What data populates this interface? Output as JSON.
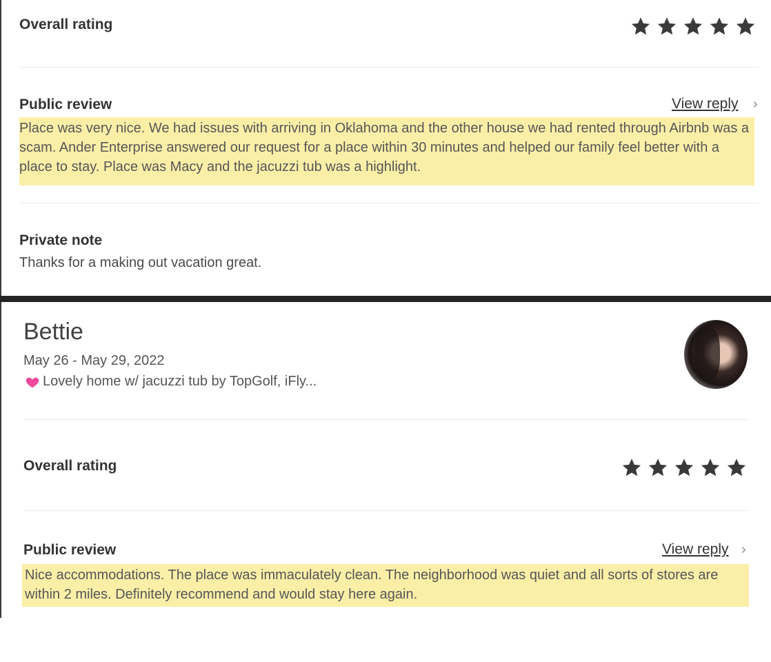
{
  "first_review": {
    "overall_rating_label": "Overall rating",
    "rating_stars": 5,
    "public_review_label": "Public review",
    "view_reply_label": "View reply",
    "public_review_text": "Place was very nice. We had issues with arriving in Oklahoma and the other house we had rented through Airbnb was a scam. Ander Enterprise answered our request for a place within 30 minutes and helped our family feel better with a place to stay. Place was Macy and the jacuzzi tub was a highlight.",
    "private_note_label": "Private note",
    "private_note_text": "Thanks for a making out vacation great."
  },
  "second_review": {
    "guest_name": "Bettie",
    "stay_dates": "May 26 - May 29, 2022",
    "listing_title": "Lovely home w/ jacuzzi tub by TopGolf, iFly...",
    "overall_rating_label": "Overall rating",
    "rating_stars": 5,
    "public_review_label": "Public review",
    "view_reply_label": "View reply",
    "public_review_text": "Nice accommodations. The place was immaculately clean. The neighborhood was quiet and all sorts of stores are within 2 miles. Definitely recommend and would stay here again."
  },
  "colors": {
    "highlight": "#fbefa8",
    "divider": "#242424",
    "heart": "#f0489a"
  },
  "icons": {
    "star": "star-icon",
    "chevron": "chevron-right-icon",
    "listing": "heart-icon"
  }
}
